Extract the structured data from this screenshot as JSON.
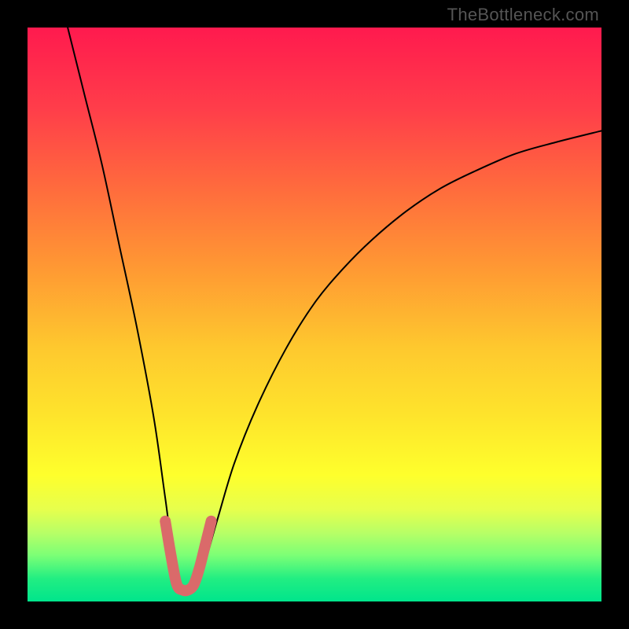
{
  "watermark": "TheBottleneck.com",
  "colors": {
    "frame": "#000000",
    "gradient_top": "#ff1a4e",
    "gradient_mid": "#fee52c",
    "gradient_bottom": "#00e58c",
    "curve": "#000000",
    "trough_highlight": "#da6a6a",
    "watermark": "#555555"
  },
  "chart_data": {
    "type": "line",
    "title": "",
    "xlabel": "",
    "ylabel": "",
    "xlim": [
      0,
      100
    ],
    "ylim": [
      0,
      100
    ],
    "note": "Axes are abstract (no tick labels in source). x≈relative hardware balance, y≈bottleneck percentage. Values estimated from pixel positions.",
    "series": [
      {
        "name": "bottleneck-curve",
        "x": [
          7,
          10,
          13,
          16,
          19,
          22,
          24,
          26,
          28,
          30,
          33,
          36,
          40,
          45,
          50,
          55,
          60,
          66,
          72,
          78,
          85,
          92,
          100
        ],
        "values": [
          100,
          88,
          76,
          62,
          48,
          32,
          18,
          4,
          2,
          4,
          14,
          24,
          34,
          44,
          52,
          58,
          63,
          68,
          72,
          75,
          78,
          80,
          82
        ]
      },
      {
        "name": "trough-highlight",
        "x": [
          24,
          25,
          26,
          27,
          28,
          29,
          30,
          31,
          32
        ],
        "values": [
          14,
          8,
          3,
          2,
          2,
          3,
          6,
          10,
          14
        ]
      }
    ],
    "minimum": {
      "x": 27.5,
      "y": 2
    }
  }
}
